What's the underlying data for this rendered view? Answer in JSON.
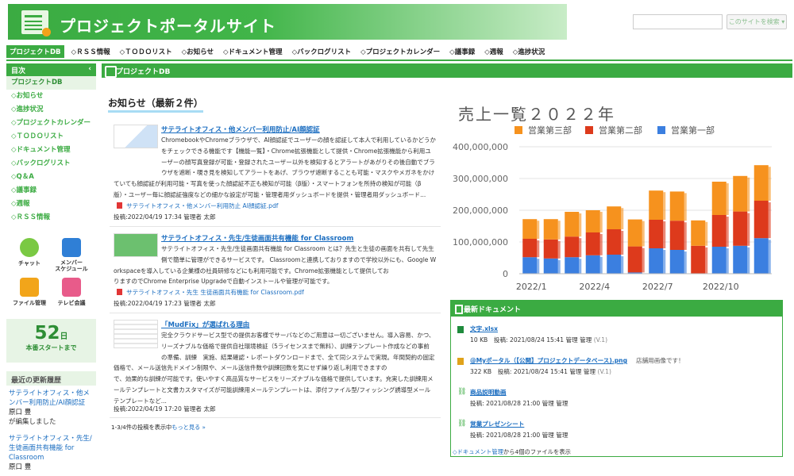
{
  "site": {
    "title": "プロジェクトポータルサイト",
    "search_button": "このサイトを検索 ▾"
  },
  "nav": [
    "プロジェクトDB",
    "◇ＲＳＳ情報",
    "◇ＴＯＤＯリスト",
    "◇お知らせ",
    "◇ドキュメント管理",
    "◇バックログリスト",
    "◇プロジェクトカレンダー",
    "◇議事録",
    "◇週報",
    "◇進捗状況"
  ],
  "sidebar": {
    "head": "目次",
    "collapse": "‹",
    "items": [
      "プロジェクトDB",
      "◇お知らせ",
      "◇進捗状況",
      "◇プロジェクトカレンダー",
      "◇ＴＯＤＯリスト",
      "◇ドキュメント管理",
      "◇バックログリスト",
      "◇Q＆A",
      "◇議事録",
      "◇週報",
      "◇ＲＳＳ情報"
    ],
    "apps": [
      {
        "label": "チャット",
        "icon": "chat-icon",
        "color": "#7ac943"
      },
      {
        "label": "メンバー\nスケジュール",
        "icon": "calendar-icon",
        "color": "#2f7fd6"
      },
      {
        "label": "ファイル管理",
        "icon": "folder-icon",
        "color": "#f2a51a"
      },
      {
        "label": "テレビ会議",
        "icon": "video-icon",
        "color": "#e85b8a"
      }
    ],
    "countdown": {
      "num": "52",
      "unit": "日",
      "label": "本番スタートまで"
    },
    "updates_head": "最近の更新履歴",
    "updates": [
      {
        "title": "サテライトオフィス・他メンバー利用防止/AI顔認証",
        "user": "原口 豊",
        "action": "が編集しました"
      },
      {
        "title": "サテライトオフィス・先生/生徒画面共有機能 for Classroom",
        "user": "原口 豊",
        "action": ""
      }
    ]
  },
  "panel": {
    "title": "プロジェクトDB"
  },
  "news": {
    "title": "お知らせ（最新２件）",
    "items": [
      {
        "title": "サテライトオフィス・他メンバー利用防止/AI顔認証",
        "line1": "ChromebookやChromeブラウザで、AI顔認証でユーザーの顔を認証して本人で利用しているかどうか",
        "line2": "をチェックできる機能です【機能一覧】・Chrome拡張機能として提供・Chrome拡張機能から利用ユ",
        "line3": "ーザーの顔写真登録が可能・登録されたユーザー以外を検知するとアラートがあがりその後自動でブラ",
        "line4": "ウザを遮断・覗き見を検知してアラートをあげ、ブラウザ遮断することも可能・マスクやメガネをかけ",
        "line5": "ていても顔認証が利用可能・写真を使った顔認証不正も検知が可能（β版）・スマートフォンを所持の検知が可能（β",
        "line6": "版）・ユーザー毎に顔認証強度などの細かな設定が可能・管理者用ダッシュボードを提供・管理者用ダッシュボード...",
        "attach": "サテライトオフィス・他メンバー利用防止 AI顔認証.pdf",
        "posted": "投稿:2022/04/19 17:34 管理者 太郎"
      },
      {
        "title": "サテライトオフィス・先生/生徒画面共有機能 for Classroom",
        "line1": "サテライトオフィス・先生/生徒画面共有機能 for Classroom とは？先生と生徒の画面を共有して先生",
        "line2": "側で簡単に管理ができるサービスです。 Classroomと連携しておりますので学校以外にも、Google W",
        "line3": "orkspaceを導入している企業様の社員研修などにも利用可能です。Chrome拡張機能として提供してお",
        "line4": "りますのでChrome Enterprise Upgradeで自動インストールや管理が可能です。",
        "attach": "サテライトオフィス・先生 生徒画面共有機能 for Classroom.pdf",
        "posted": "投稿:2022/04/19 17:23 管理者 太郎"
      },
      {
        "title": "「MudFix」が選ばれる理由",
        "line1": "完全クラウドサービス型での提供お客様でサーバなどのご用意は一切ございません。導入容易、かつ、",
        "line2": "リーズナブルな価格で提供自社環境検証（5ライセンスまで無料）、訓練テンプレート作成などの事前",
        "line3": "の準備、訓練　実施、結果確認・レポートダウンロードまで、全て同システムで実現。年間契約の固定",
        "line4": "価格で、メール送信先ドメイン制限や、メール送信件数や訓練回数を気にせず繰り返し利用できますの",
        "line5": "で、効果的な訓練が可能です。使いやすく高品質なサービスをリーズナブルな価格で提供しています。充実した訓練用メ",
        "line6": "ールテンプレートと文書カスタマイズが可能訓練用メールテンプレートは、添付ファイル型/フィッシング誘導型メール",
        "line7": "テンプレートなど...",
        "posted": "投稿:2022/04/19 17:20 管理者 太郎"
      }
    ],
    "pager_pre": "1-3/4件の投稿を表示中",
    "pager_more": "もっと見る »"
  },
  "docs": {
    "head": "最新ドキュメント",
    "items": [
      {
        "name": "文字.xlsx",
        "meta": "10 KB　投稿: 2021/08/24 15:41 管理 管理",
        "ver": "(V.1)",
        "note": "",
        "icon": "excel-icon",
        "color": "#1f8b3d"
      },
      {
        "name": "@Myポータル（【公開】プロジェクトデータベース).png",
        "meta": "322 KB　投稿: 2021/08/24 15:41 管理 管理",
        "ver": "(V.1)",
        "note": "店舗用画像です！",
        "icon": "image-icon",
        "color": "#e0a21a"
      },
      {
        "name": "商品説明動画",
        "meta": "投稿: 2021/08/28 21:00 管理 管理",
        "ver": "",
        "note": "",
        "icon": "link-icon",
        "color": "#3bab42"
      },
      {
        "name": "営業プレゼンシート",
        "meta": "投稿: 2021/08/28 21:00 管理 管理",
        "ver": "",
        "note": "",
        "icon": "link-icon",
        "color": "#3bab42"
      }
    ],
    "foot_link": "◇ドキュメント管理",
    "foot_text": "から4個のファイルを表示"
  },
  "chart_data": {
    "type": "bar",
    "stacked": true,
    "title": "売上一覧２０２２年",
    "x_tick_labels": [
      "2022/1",
      "2022/4",
      "2022/7",
      "2022/10"
    ],
    "ylim": [
      0,
      400000000
    ],
    "yticks": [
      "0",
      "100,000,000",
      "200,000,000",
      "300,000,000",
      "400,000,000"
    ],
    "legend_position": "top",
    "series": [
      {
        "name": "営業第一部",
        "color": "#3b7fe0",
        "values": [
          52000000,
          48000000,
          52000000,
          58000000,
          60000000,
          4000000,
          80000000,
          75000000,
          0,
          85000000,
          88000000,
          112000000
        ]
      },
      {
        "name": "営業第二部",
        "color": "#dd3a1c",
        "values": [
          58000000,
          60000000,
          65000000,
          72000000,
          80000000,
          82000000,
          90000000,
          92000000,
          88000000,
          100000000,
          108000000,
          118000000
        ]
      },
      {
        "name": "営業第三部",
        "color": "#f6921e",
        "values": [
          62000000,
          64000000,
          78000000,
          70000000,
          72000000,
          85000000,
          92000000,
          92000000,
          80000000,
          105000000,
          112000000,
          112000000
        ]
      }
    ]
  }
}
